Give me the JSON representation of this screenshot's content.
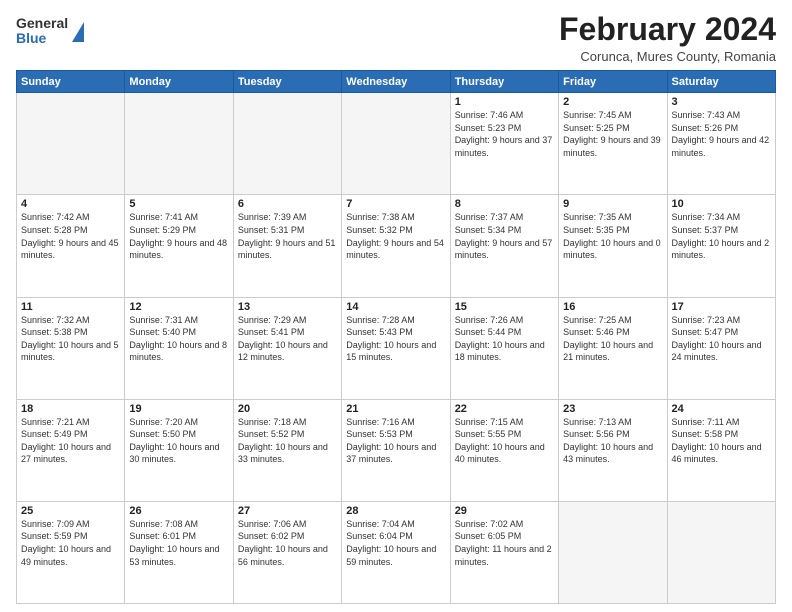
{
  "header": {
    "logo_general": "General",
    "logo_blue": "Blue",
    "month_title": "February 2024",
    "location": "Corunca, Mures County, Romania"
  },
  "days_of_week": [
    "Sunday",
    "Monday",
    "Tuesday",
    "Wednesday",
    "Thursday",
    "Friday",
    "Saturday"
  ],
  "weeks": [
    [
      {
        "day": "",
        "info": ""
      },
      {
        "day": "",
        "info": ""
      },
      {
        "day": "",
        "info": ""
      },
      {
        "day": "",
        "info": ""
      },
      {
        "day": "1",
        "info": "Sunrise: 7:46 AM\nSunset: 5:23 PM\nDaylight: 9 hours\nand 37 minutes."
      },
      {
        "day": "2",
        "info": "Sunrise: 7:45 AM\nSunset: 5:25 PM\nDaylight: 9 hours\nand 39 minutes."
      },
      {
        "day": "3",
        "info": "Sunrise: 7:43 AM\nSunset: 5:26 PM\nDaylight: 9 hours\nand 42 minutes."
      }
    ],
    [
      {
        "day": "4",
        "info": "Sunrise: 7:42 AM\nSunset: 5:28 PM\nDaylight: 9 hours\nand 45 minutes."
      },
      {
        "day": "5",
        "info": "Sunrise: 7:41 AM\nSunset: 5:29 PM\nDaylight: 9 hours\nand 48 minutes."
      },
      {
        "day": "6",
        "info": "Sunrise: 7:39 AM\nSunset: 5:31 PM\nDaylight: 9 hours\nand 51 minutes."
      },
      {
        "day": "7",
        "info": "Sunrise: 7:38 AM\nSunset: 5:32 PM\nDaylight: 9 hours\nand 54 minutes."
      },
      {
        "day": "8",
        "info": "Sunrise: 7:37 AM\nSunset: 5:34 PM\nDaylight: 9 hours\nand 57 minutes."
      },
      {
        "day": "9",
        "info": "Sunrise: 7:35 AM\nSunset: 5:35 PM\nDaylight: 10 hours\nand 0 minutes."
      },
      {
        "day": "10",
        "info": "Sunrise: 7:34 AM\nSunset: 5:37 PM\nDaylight: 10 hours\nand 2 minutes."
      }
    ],
    [
      {
        "day": "11",
        "info": "Sunrise: 7:32 AM\nSunset: 5:38 PM\nDaylight: 10 hours\nand 5 minutes."
      },
      {
        "day": "12",
        "info": "Sunrise: 7:31 AM\nSunset: 5:40 PM\nDaylight: 10 hours\nand 8 minutes."
      },
      {
        "day": "13",
        "info": "Sunrise: 7:29 AM\nSunset: 5:41 PM\nDaylight: 10 hours\nand 12 minutes."
      },
      {
        "day": "14",
        "info": "Sunrise: 7:28 AM\nSunset: 5:43 PM\nDaylight: 10 hours\nand 15 minutes."
      },
      {
        "day": "15",
        "info": "Sunrise: 7:26 AM\nSunset: 5:44 PM\nDaylight: 10 hours\nand 18 minutes."
      },
      {
        "day": "16",
        "info": "Sunrise: 7:25 AM\nSunset: 5:46 PM\nDaylight: 10 hours\nand 21 minutes."
      },
      {
        "day": "17",
        "info": "Sunrise: 7:23 AM\nSunset: 5:47 PM\nDaylight: 10 hours\nand 24 minutes."
      }
    ],
    [
      {
        "day": "18",
        "info": "Sunrise: 7:21 AM\nSunset: 5:49 PM\nDaylight: 10 hours\nand 27 minutes."
      },
      {
        "day": "19",
        "info": "Sunrise: 7:20 AM\nSunset: 5:50 PM\nDaylight: 10 hours\nand 30 minutes."
      },
      {
        "day": "20",
        "info": "Sunrise: 7:18 AM\nSunset: 5:52 PM\nDaylight: 10 hours\nand 33 minutes."
      },
      {
        "day": "21",
        "info": "Sunrise: 7:16 AM\nSunset: 5:53 PM\nDaylight: 10 hours\nand 37 minutes."
      },
      {
        "day": "22",
        "info": "Sunrise: 7:15 AM\nSunset: 5:55 PM\nDaylight: 10 hours\nand 40 minutes."
      },
      {
        "day": "23",
        "info": "Sunrise: 7:13 AM\nSunset: 5:56 PM\nDaylight: 10 hours\nand 43 minutes."
      },
      {
        "day": "24",
        "info": "Sunrise: 7:11 AM\nSunset: 5:58 PM\nDaylight: 10 hours\nand 46 minutes."
      }
    ],
    [
      {
        "day": "25",
        "info": "Sunrise: 7:09 AM\nSunset: 5:59 PM\nDaylight: 10 hours\nand 49 minutes."
      },
      {
        "day": "26",
        "info": "Sunrise: 7:08 AM\nSunset: 6:01 PM\nDaylight: 10 hours\nand 53 minutes."
      },
      {
        "day": "27",
        "info": "Sunrise: 7:06 AM\nSunset: 6:02 PM\nDaylight: 10 hours\nand 56 minutes."
      },
      {
        "day": "28",
        "info": "Sunrise: 7:04 AM\nSunset: 6:04 PM\nDaylight: 10 hours\nand 59 minutes."
      },
      {
        "day": "29",
        "info": "Sunrise: 7:02 AM\nSunset: 6:05 PM\nDaylight: 11 hours\nand 2 minutes."
      },
      {
        "day": "",
        "info": ""
      },
      {
        "day": "",
        "info": ""
      }
    ]
  ]
}
